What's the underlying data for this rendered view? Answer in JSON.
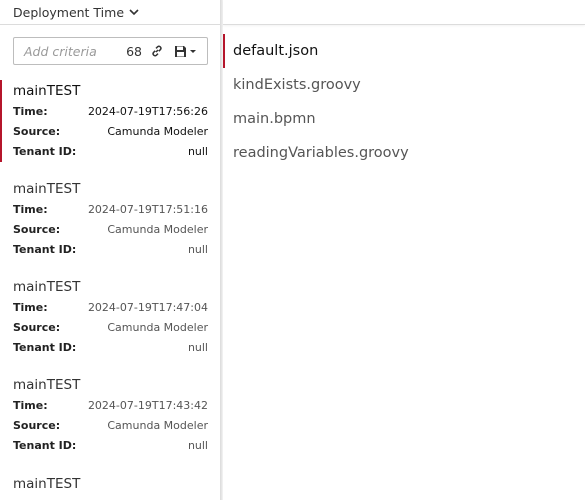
{
  "sort": {
    "label": "Deployment Time"
  },
  "search": {
    "placeholder": "Add criteria",
    "count": "68"
  },
  "labels": {
    "time": "Time:",
    "source": "Source:",
    "tenant": "Tenant ID:"
  },
  "deployments": [
    {
      "name": "mainTEST",
      "time": "2024-07-19T17:56:26",
      "source": "Camunda Modeler",
      "tenant": "null"
    },
    {
      "name": "mainTEST",
      "time": "2024-07-19T17:51:16",
      "source": "Camunda Modeler",
      "tenant": "null"
    },
    {
      "name": "mainTEST",
      "time": "2024-07-19T17:47:04",
      "source": "Camunda Modeler",
      "tenant": "null"
    },
    {
      "name": "mainTEST",
      "time": "2024-07-19T17:43:42",
      "source": "Camunda Modeler",
      "tenant": "null"
    },
    {
      "name": "mainTEST"
    }
  ],
  "files": [
    "default.json",
    "kindExists.groovy",
    "main.bpmn",
    "readingVariables.groovy"
  ],
  "colors": {
    "accent": "#b5152b"
  }
}
